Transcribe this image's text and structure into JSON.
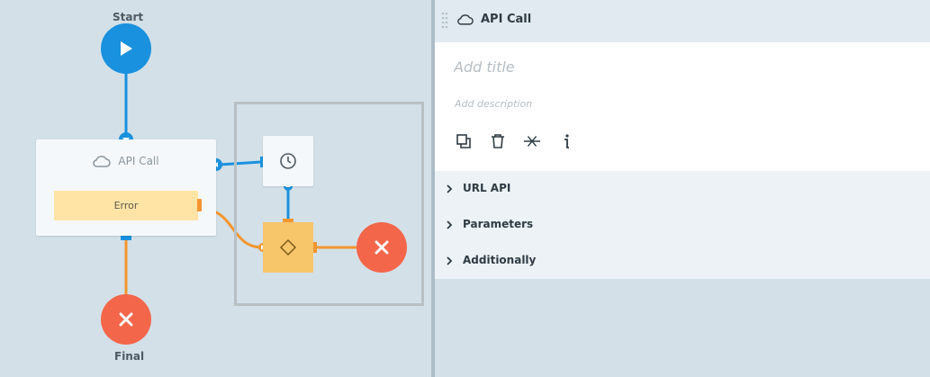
{
  "canvas": {
    "start_label": "Start",
    "final_label": "Final",
    "api_node": {
      "label": "API Call",
      "error_label": "Error"
    }
  },
  "panel": {
    "header_title": "API Call",
    "title_placeholder": "Add title",
    "description_placeholder": "Add description",
    "toolbar": [
      "copy-icon",
      "delete-icon",
      "disconnect-icon",
      "info-icon"
    ],
    "sections": [
      {
        "label": "URL API"
      },
      {
        "label": "Parameters"
      },
      {
        "label": "Additionally"
      }
    ]
  },
  "colors": {
    "blue": "#1a91de",
    "orange": "#f3962f",
    "red": "#f4664a",
    "error_bg": "#ffe4a6",
    "condition": "#f8c66a"
  }
}
